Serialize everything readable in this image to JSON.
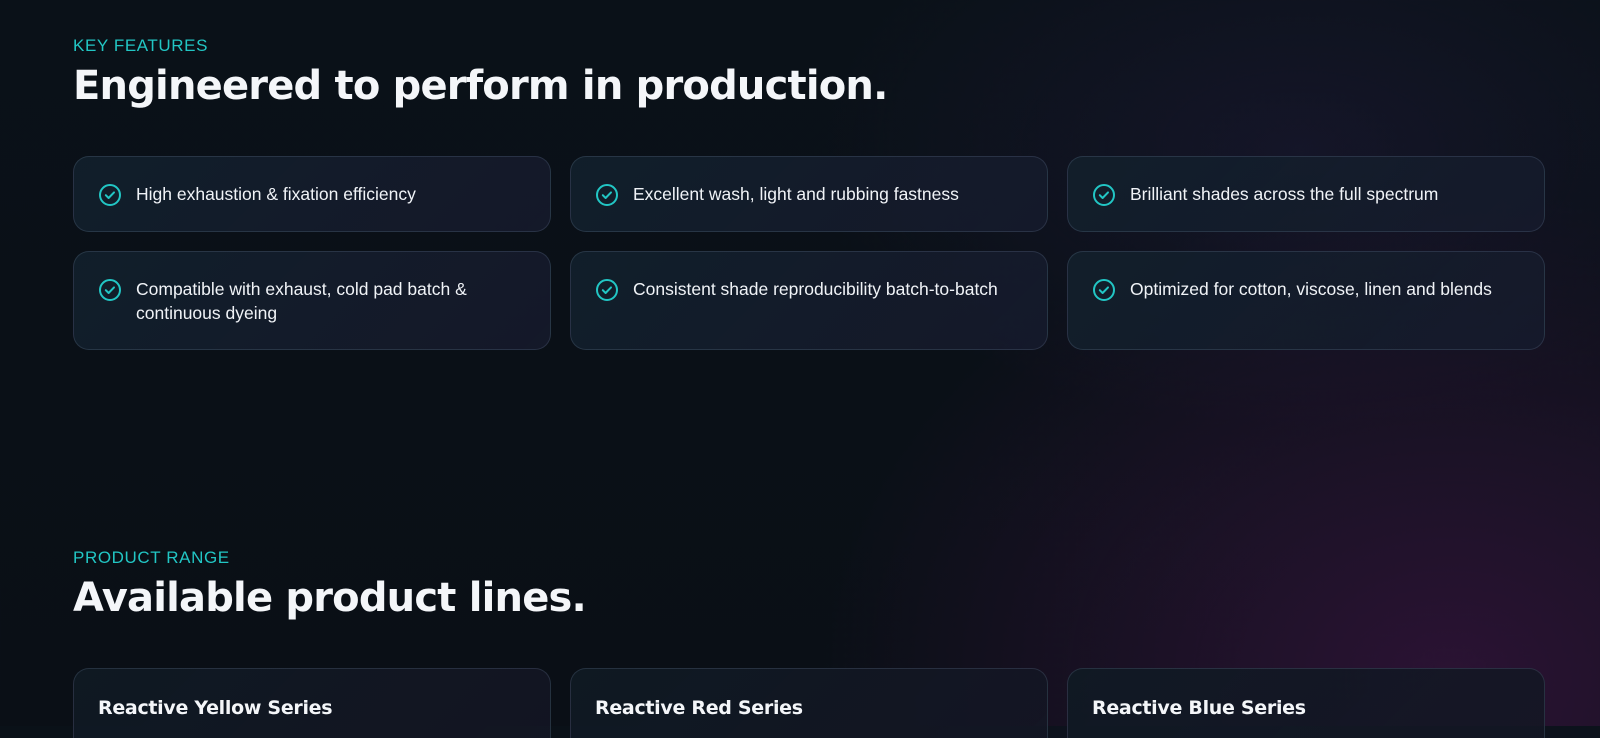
{
  "features_section": {
    "eyebrow": "KEY FEATURES",
    "title": "Engineered to perform in production.",
    "items": [
      "High exhaustion & fixation efficiency",
      "Excellent wash, light and rubbing fastness",
      "Brilliant shades across the full spectrum",
      "Compatible with exhaust, cold pad batch & continuous dyeing",
      "Consistent shade reproducibility batch-to-batch",
      "Optimized for cotton, viscose, linen and blends"
    ],
    "icon": "check-circle-icon"
  },
  "products_section": {
    "eyebrow": "PRODUCT RANGE",
    "title": "Available product lines.",
    "items": [
      "Reactive Yellow Series",
      "Reactive Red Series",
      "Reactive Blue Series"
    ]
  },
  "colors": {
    "accent": "#22c6c4",
    "background": "#0a1118",
    "text": "#f4f6f9"
  }
}
